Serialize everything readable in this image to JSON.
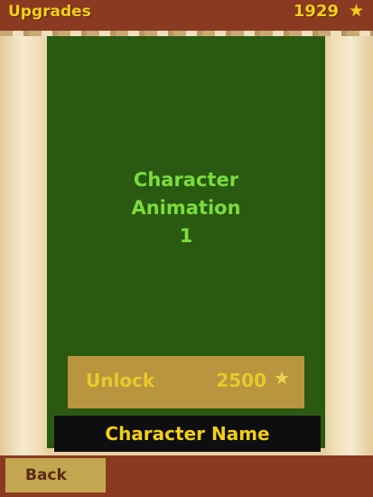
{
  "header": {
    "title": "Upgrades",
    "coins": "1929",
    "coin_icon": "star-icon"
  },
  "card": {
    "preview_lines": [
      "Character",
      "Animation",
      "1"
    ],
    "unlock": {
      "label": "Unlock",
      "price": "2500",
      "price_icon": "star-icon"
    },
    "character_name": "Character Name"
  },
  "footer": {
    "back_label": "Back"
  },
  "colors": {
    "bar": "#8b3a22",
    "panel": "#2a5a12",
    "accent_yellow": "#f1cf18",
    "preview_text": "#7bdc3c",
    "unlock_button": "#b9953f",
    "back_button": "#c3a650"
  }
}
